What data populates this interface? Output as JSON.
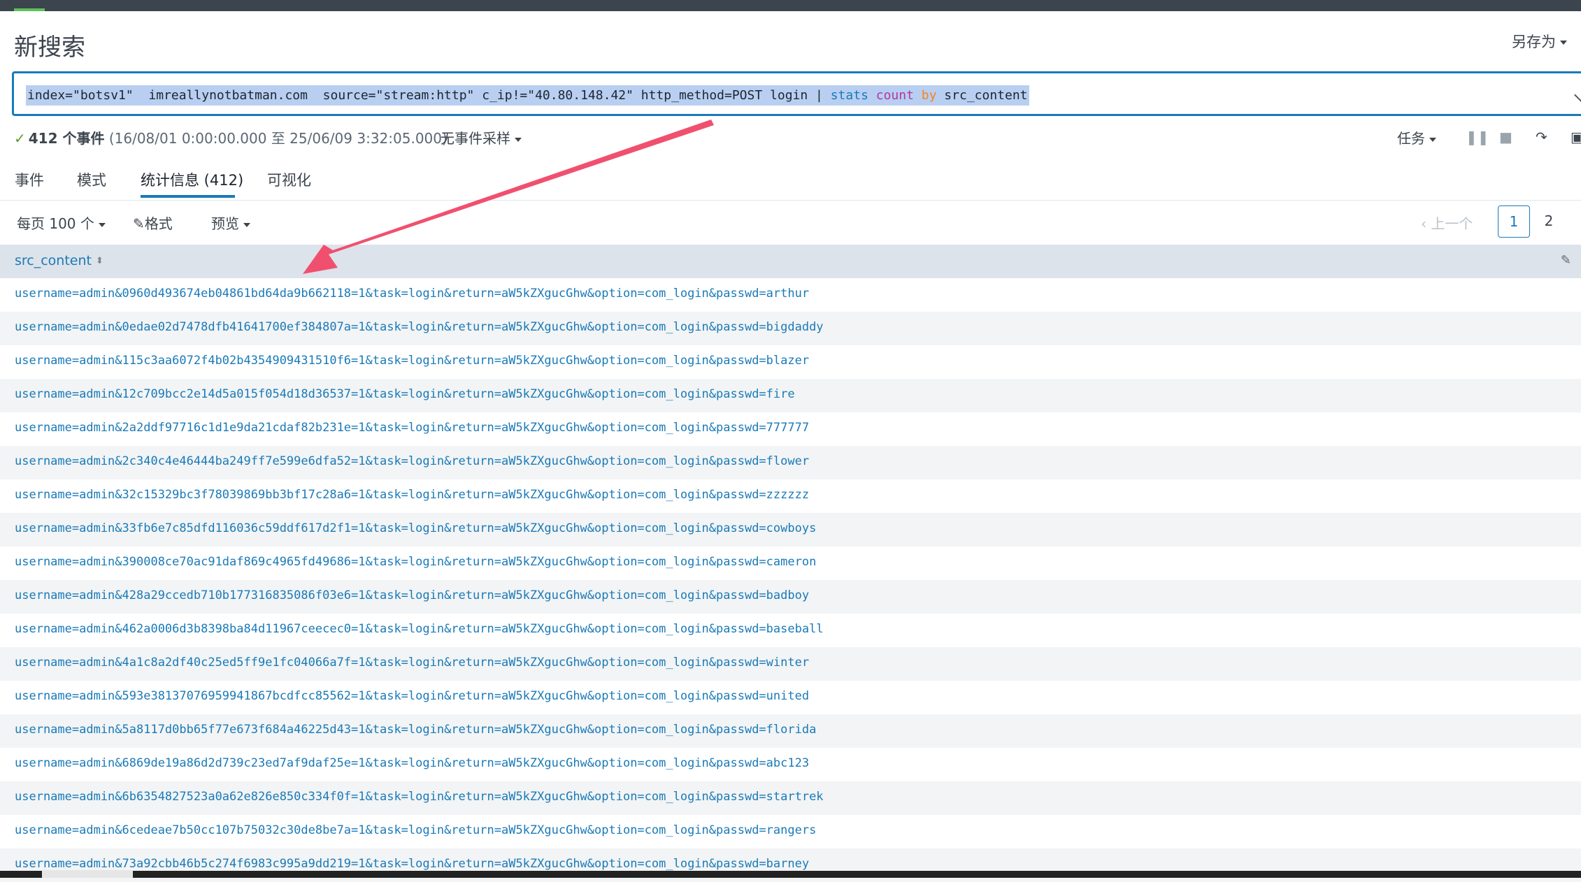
{
  "page": {
    "title": "新搜索",
    "save_as": "另存为"
  },
  "search": {
    "q1": "index=\"botsv1\"  imreallynotbatman.com  source=\"stream:http\" c_ip!=\"40.80.148.42\" http_method=POST login | ",
    "q_cmd": "stats",
    "q_sp1": " ",
    "q_fn": "count",
    "q_sp2": " ",
    "q_by": "by",
    "q_tail": " src_content"
  },
  "status": {
    "count": "412 个事件",
    "range": "(16/08/01 0:00:00.000 至 25/06/09 3:32:05.000)",
    "sampling": "无事件采样"
  },
  "job": {
    "label": "任务"
  },
  "tabs": [
    "事件",
    "模式",
    "统计信息 (412)",
    "可视化"
  ],
  "toolbar": {
    "per_page": "每页 100 个",
    "format": "格式",
    "preview": "预览"
  },
  "pager": {
    "prev": "上一个",
    "current": "1",
    "next_page": "2"
  },
  "table": {
    "column": "src_content",
    "rows": [
      "username=admin&0960d493674eb04861bd64da9b662118=1&task=login&return=aW5kZXgucGhw&option=com_login&passwd=arthur",
      "username=admin&0edae02d7478dfb41641700ef384807a=1&task=login&return=aW5kZXgucGhw&option=com_login&passwd=bigdaddy",
      "username=admin&115c3aa6072f4b02b4354909431510f6=1&task=login&return=aW5kZXgucGhw&option=com_login&passwd=blazer",
      "username=admin&12c709bcc2e14d5a015f054d18d36537=1&task=login&return=aW5kZXgucGhw&option=com_login&passwd=fire",
      "username=admin&2a2ddf97716c1d1e9da21cdaf82b231e=1&task=login&return=aW5kZXgucGhw&option=com_login&passwd=777777",
      "username=admin&2c340c4e46444ba249ff7e599e6dfa52=1&task=login&return=aW5kZXgucGhw&option=com_login&passwd=flower",
      "username=admin&32c15329bc3f78039869bb3bf17c28a6=1&task=login&return=aW5kZXgucGhw&option=com_login&passwd=zzzzzz",
      "username=admin&33fb6e7c85dfd116036c59ddf617d2f1=1&task=login&return=aW5kZXgucGhw&option=com_login&passwd=cowboys",
      "username=admin&390008ce70ac91daf869c4965fd49686=1&task=login&return=aW5kZXgucGhw&option=com_login&passwd=cameron",
      "username=admin&428a29ccedb710b177316835086f03e6=1&task=login&return=aW5kZXgucGhw&option=com_login&passwd=badboy",
      "username=admin&462a0006d3b8398ba84d11967ceecec0=1&task=login&return=aW5kZXgucGhw&option=com_login&passwd=baseball",
      "username=admin&4a1c8a2df40c25ed5ff9e1fc04066a7f=1&task=login&return=aW5kZXgucGhw&option=com_login&passwd=winter",
      "username=admin&593e38137076959941867bcdfcc85562=1&task=login&return=aW5kZXgucGhw&option=com_login&passwd=united",
      "username=admin&5a8117d0bb65f77e673f684a46225d43=1&task=login&return=aW5kZXgucGhw&option=com_login&passwd=florida",
      "username=admin&6869de19a86d2d739c23ed7af9daf25e=1&task=login&return=aW5kZXgucGhw&option=com_login&passwd=abc123",
      "username=admin&6b6354827523a0a62e826e850c334f0f=1&task=login&return=aW5kZXgucGhw&option=com_login&passwd=startrek",
      "username=admin&6cedeae7b50cc107b75032c30de8be7a=1&task=login&return=aW5kZXgucGhw&option=com_login&passwd=rangers",
      "username=admin&73a92cbb46b5c274f6983c995a9dd219=1&task=login&return=aW5kZXgucGhw&option=com_login&passwd=barney"
    ]
  },
  "colors": {
    "accent": "#1a7ab8",
    "highlight": "#b8cff1",
    "arrow": "#f0506e",
    "header_bg": "#dde3ea"
  }
}
